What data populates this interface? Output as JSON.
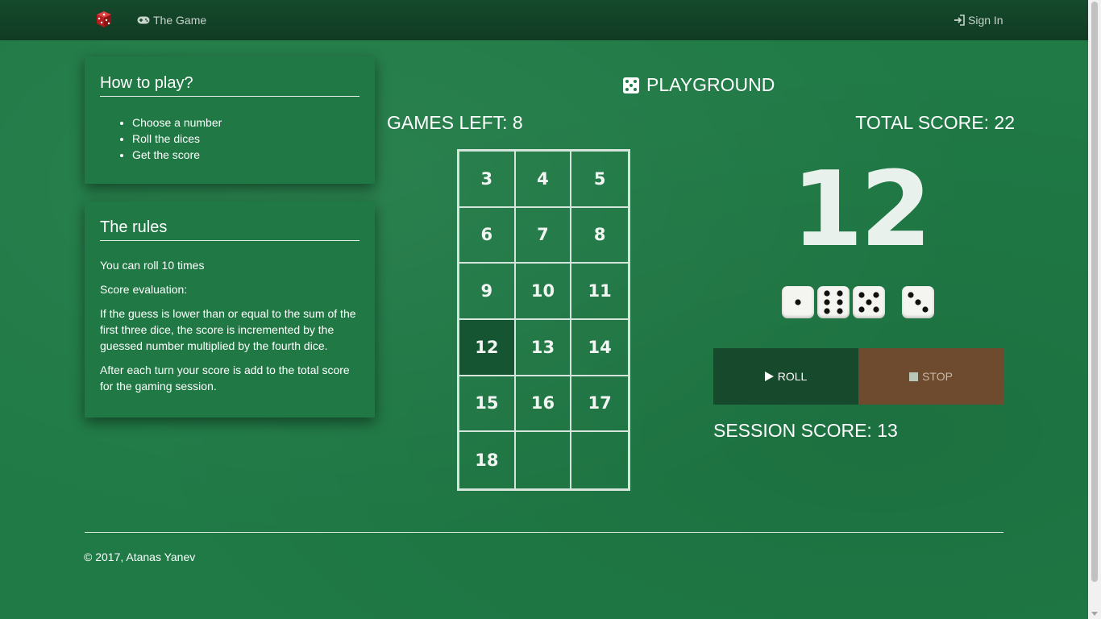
{
  "navbar": {
    "brand_icon": "dice-icon",
    "game_label": "The Game",
    "game_icon": "gamepad-icon",
    "signin_label": "Sign In",
    "signin_icon": "sign-in-icon"
  },
  "howto": {
    "title": "How to play?",
    "items": [
      "Choose a number",
      "Roll the dices",
      "Get the score"
    ]
  },
  "rules": {
    "title": "The rules",
    "paragraphs": [
      "You can roll 10 times",
      "Score evaluation:",
      "If the guess is lower than or equal to the sum of the first three dice, the score is incremented by the guessed number multiplied by the fourth dice.",
      "After each turn your score is add to the total score for the gaming session."
    ]
  },
  "playground": {
    "title": "PLAYGROUND",
    "title_icon": "dice-icon",
    "games_left": "GAMES LEFT: 8",
    "total_score": "TOTAL SCORE: 22",
    "numbers": [
      "3",
      "4",
      "5",
      "6",
      "7",
      "8",
      "9",
      "10",
      "11",
      "12",
      "13",
      "14",
      "15",
      "16",
      "17",
      "18",
      "",
      ""
    ],
    "selected_number": "12",
    "big_number": "12",
    "dice_values": [
      1,
      6,
      5,
      3
    ],
    "roll_label": "ROLL",
    "roll_icon": "play-icon",
    "stop_label": "STOP",
    "stop_icon": "stop-icon",
    "session_score": "SESSION SCORE: 13"
  },
  "footer": {
    "copyright": "© 2017, Atanas Yanev"
  },
  "colors": {
    "felt": "#1f7a45",
    "navbar": "#123f26",
    "roll_button": "#174a2d",
    "stop_button": "#6e4a2e",
    "selected_cell": "#155532"
  }
}
